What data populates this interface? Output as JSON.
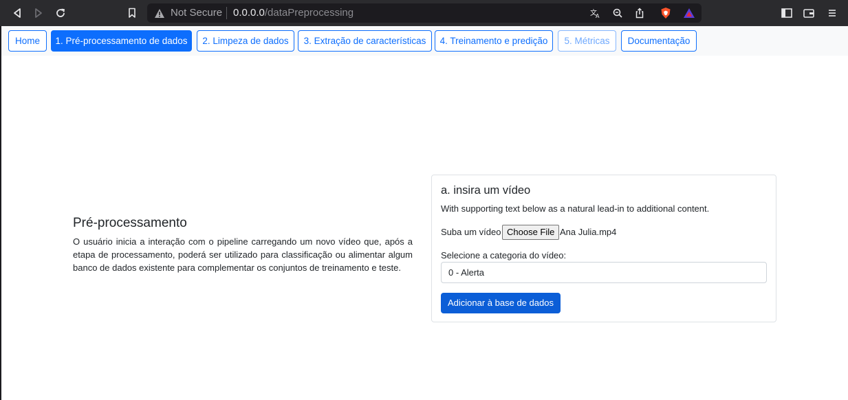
{
  "browser": {
    "security_label": "Not Secure",
    "url_host": "0.0.0.0",
    "url_path": "/dataPreprocessing"
  },
  "nav": {
    "home": "Home",
    "preprocessing": "1. Pré-processamento de dados",
    "cleaning": "2. Limpeza de dados",
    "features": "3. Extração de características",
    "training": "4. Treinamento e predição",
    "metrics": "5. Métricas",
    "docs": "Documentação"
  },
  "intro": {
    "title": "Pré-processamento",
    "text": "O usuário inicia a interação com o pipeline carregando um novo vídeo que, após a etapa de processamento, poderá ser utilizado para classificação ou alimentar algum banco de dados existente para complementar os conjuntos de treinamento e teste."
  },
  "card": {
    "title": "a. insira um vídeo",
    "text": "With supporting text below as a natural lead-in to additional content.",
    "upload_label": "Suba um vídeo",
    "file_button": "Choose File",
    "file_name": "Ana Julia.mp4",
    "select_label": "Selecione a categoria do vídeo:",
    "select_value": "0 - Alerta",
    "submit": "Adicionar à base de dados"
  },
  "colors": {
    "primary": "#0d6efd",
    "primary_dark": "#0b5ed7",
    "chrome_bg": "#2b2b2e",
    "navbar_bg": "#f8f9fa"
  },
  "icons": [
    "back-icon",
    "forward-icon",
    "reload-icon",
    "bookmark-icon",
    "warning-icon",
    "translate-icon",
    "zoom-icon",
    "share-icon",
    "brave-shield-icon",
    "brave-rewards-icon",
    "sidebar-icon",
    "wallet-icon",
    "menu-icon"
  ]
}
